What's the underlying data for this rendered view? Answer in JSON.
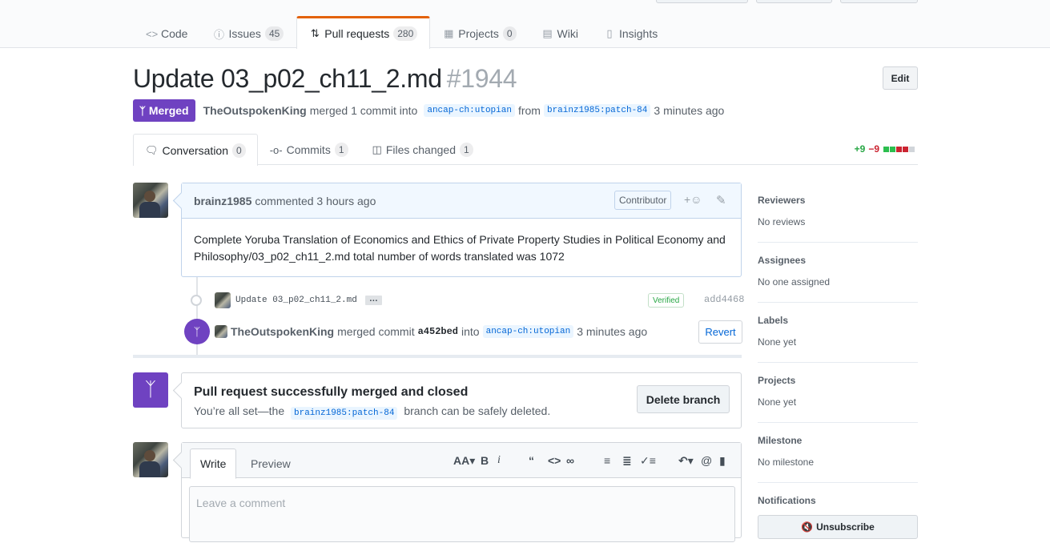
{
  "reponav": {
    "tabs": [
      {
        "label": "Code",
        "icon": "code-icon",
        "count": null
      },
      {
        "label": "Issues",
        "icon": "issue-icon",
        "count": "45"
      },
      {
        "label": "Pull requests",
        "icon": "pull-request-icon",
        "count": "280"
      },
      {
        "label": "Projects",
        "icon": "project-icon",
        "count": "0"
      },
      {
        "label": "Wiki",
        "icon": "book-icon",
        "count": null
      },
      {
        "label": "Insights",
        "icon": "graph-icon",
        "count": null
      }
    ]
  },
  "pr": {
    "title": "Update 03_p02_ch11_2.md",
    "number": "#1944",
    "edit_label": "Edit",
    "state": "Merged",
    "author": "TheOutspokenKing",
    "merged_text": "merged 1 commit into",
    "base_branch": "ancap-ch:utopian",
    "from_text": "from",
    "head_branch": "brainz1985:patch-84",
    "time": "3 minutes ago"
  },
  "tabs": [
    {
      "label": "Conversation",
      "count": "0",
      "icon": "comment-discussion-icon"
    },
    {
      "label": "Commits",
      "count": "1",
      "icon": "commit-icon"
    },
    {
      "label": "Files changed",
      "count": "1",
      "icon": "diff-icon"
    }
  ],
  "diffstat": {
    "additions": "+9",
    "deletions": "−9"
  },
  "comment": {
    "author": "brainz1985",
    "meta": "commented 3 hours ago",
    "role": "Contributor",
    "reaction": "+☺",
    "body": "Complete Yoruba Translation of Economics and Ethics of Private Property Studies in Political Economy and Philosophy/03_p02_ch11_2.md total number of words translated was 1072"
  },
  "commit": {
    "message": "Update 03_p02_ch11_2.md",
    "ellipsis": "…",
    "verified": "Verified",
    "sha": "add4468"
  },
  "merge_event": {
    "author": "TheOutspokenKing",
    "text1": "merged commit",
    "sha": "a452bed",
    "text2": "into",
    "branch": "ancap-ch:utopian",
    "time": "3 minutes ago",
    "revert_label": "Revert"
  },
  "merge_status": {
    "heading": "Pull request successfully merged and closed",
    "sub_before": "You’re all set—the",
    "branch": "brainz1985:patch-84",
    "sub_after": "branch can be safely deleted.",
    "delete_label": "Delete branch"
  },
  "new_comment": {
    "write_tab": "Write",
    "preview_tab": "Preview",
    "placeholder": "Leave a comment"
  },
  "sidebar": [
    {
      "heading": "Reviewers",
      "value": "No reviews"
    },
    {
      "heading": "Assignees",
      "value": "No one assigned"
    },
    {
      "heading": "Labels",
      "value": "None yet"
    },
    {
      "heading": "Projects",
      "value": "None yet"
    },
    {
      "heading": "Milestone",
      "value": "No milestone"
    }
  ],
  "notifications": {
    "heading": "Notifications",
    "button": "Unsubscribe"
  },
  "colors": {
    "merged": "#6f42c1",
    "tab_accent": "#e36209",
    "link": "#0366d6",
    "add": "#28a745",
    "del": "#cb2431"
  }
}
